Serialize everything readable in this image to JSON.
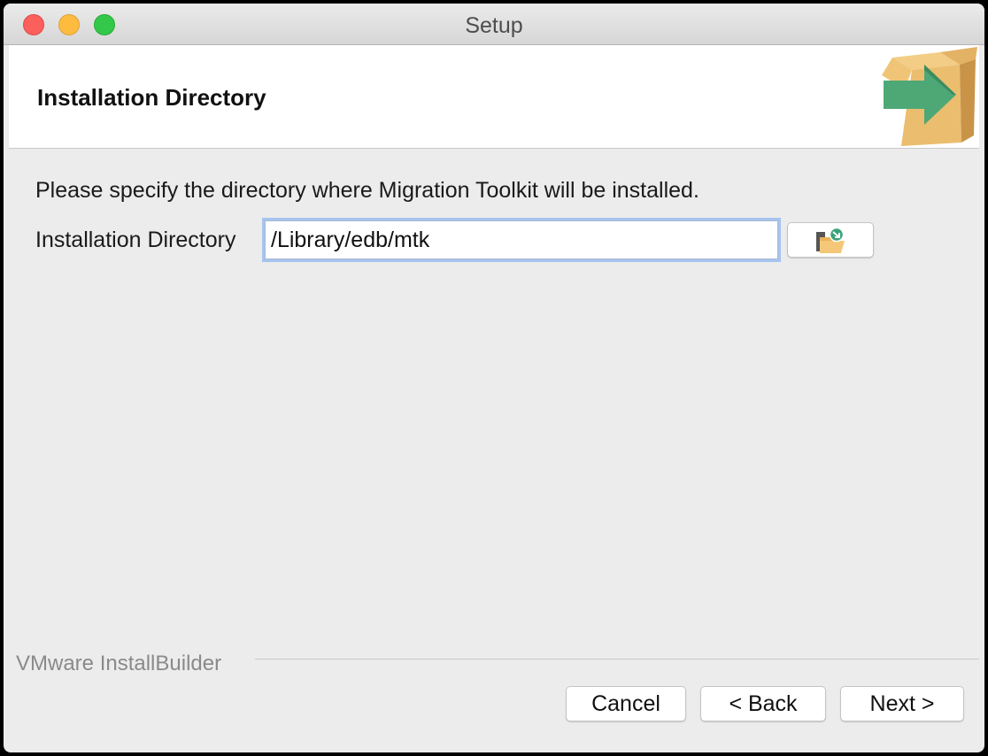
{
  "window": {
    "title": "Setup"
  },
  "header": {
    "title": "Installation Directory",
    "icon": "installer-box-arrow-icon"
  },
  "main": {
    "description": "Please specify the directory where Migration Toolkit will be installed.",
    "directory_label": "Installation Directory",
    "directory_value": "/Library/edb/mtk",
    "browse_icon": "folder-browse-icon"
  },
  "footer": {
    "vendor": "VMware InstallBuilder",
    "cancel_label": "Cancel",
    "back_label": "< Back",
    "next_label": "Next >"
  },
  "colors": {
    "close": "#fc605c",
    "minimize": "#fdbc40",
    "maximize": "#34c84a",
    "focus_ring": "#a6c4ef",
    "box": "#e8b96a",
    "arrow": "#4ea876"
  }
}
